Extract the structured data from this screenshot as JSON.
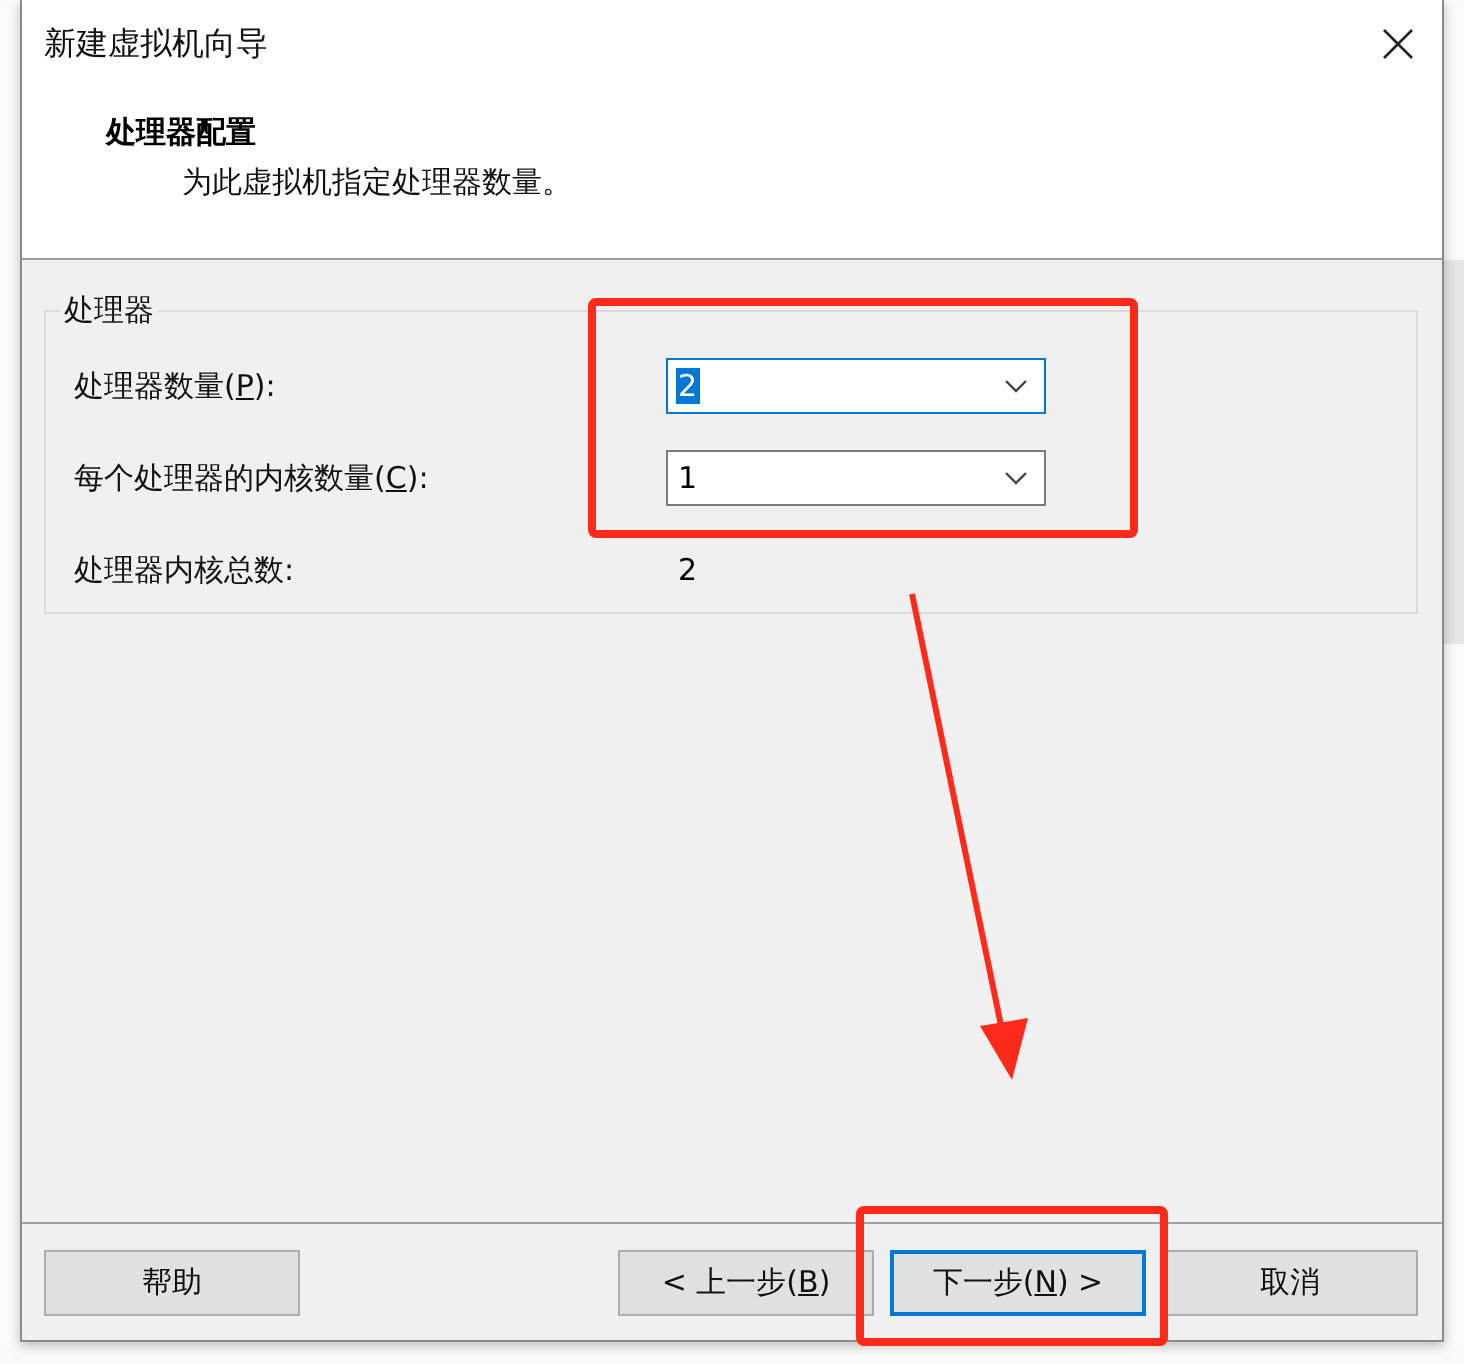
{
  "window": {
    "title": "新建虚拟机向导"
  },
  "header": {
    "title": "处理器配置",
    "subtitle": "为此虚拟机指定处理器数量。"
  },
  "group": {
    "title": "处理器",
    "fields": [
      {
        "kind": "combo",
        "label": [
          "处理器数量(",
          "P",
          "):"
        ],
        "value": "2",
        "focused": true
      },
      {
        "kind": "combo",
        "label": [
          "每个处理器的内核数量(",
          "C",
          "):"
        ],
        "value": "1",
        "focused": false
      },
      {
        "kind": "readout",
        "label": [
          "处理器内核总数:"
        ],
        "value": "2"
      }
    ]
  },
  "left_buttons": [
    {
      "label": [
        "帮助"
      ],
      "default": false
    }
  ],
  "right_buttons": [
    {
      "label": [
        "< 上一步(",
        "B",
        ")"
      ],
      "default": false
    },
    {
      "label": [
        "下一步(",
        "N",
        ") >"
      ],
      "default": true
    },
    {
      "label": [
        "取消"
      ],
      "default": false
    }
  ]
}
